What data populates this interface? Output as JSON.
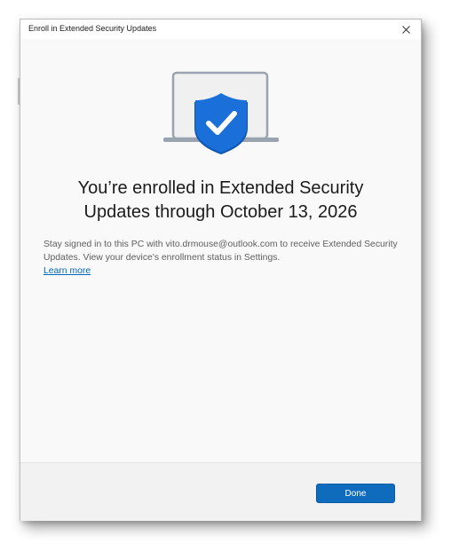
{
  "window": {
    "title": "Enroll in Extended Security Updates"
  },
  "icons": {
    "close": "close-icon",
    "hero": "laptop-shield-check-icon"
  },
  "content": {
    "heading_line1": "You’re enrolled in Extended Security",
    "heading_line2": "Updates through October 13, 2026",
    "body": "Stay signed in to this PC with vito.drmouse@outlook.com to receive Extended Security Updates. View your device's enrollment status in Settings.",
    "learn_more": "Learn more"
  },
  "footer": {
    "done_label": "Done"
  },
  "colors": {
    "accent": "#0f6cbd",
    "shield": "#1a6fd8",
    "link": "#0067c0"
  }
}
